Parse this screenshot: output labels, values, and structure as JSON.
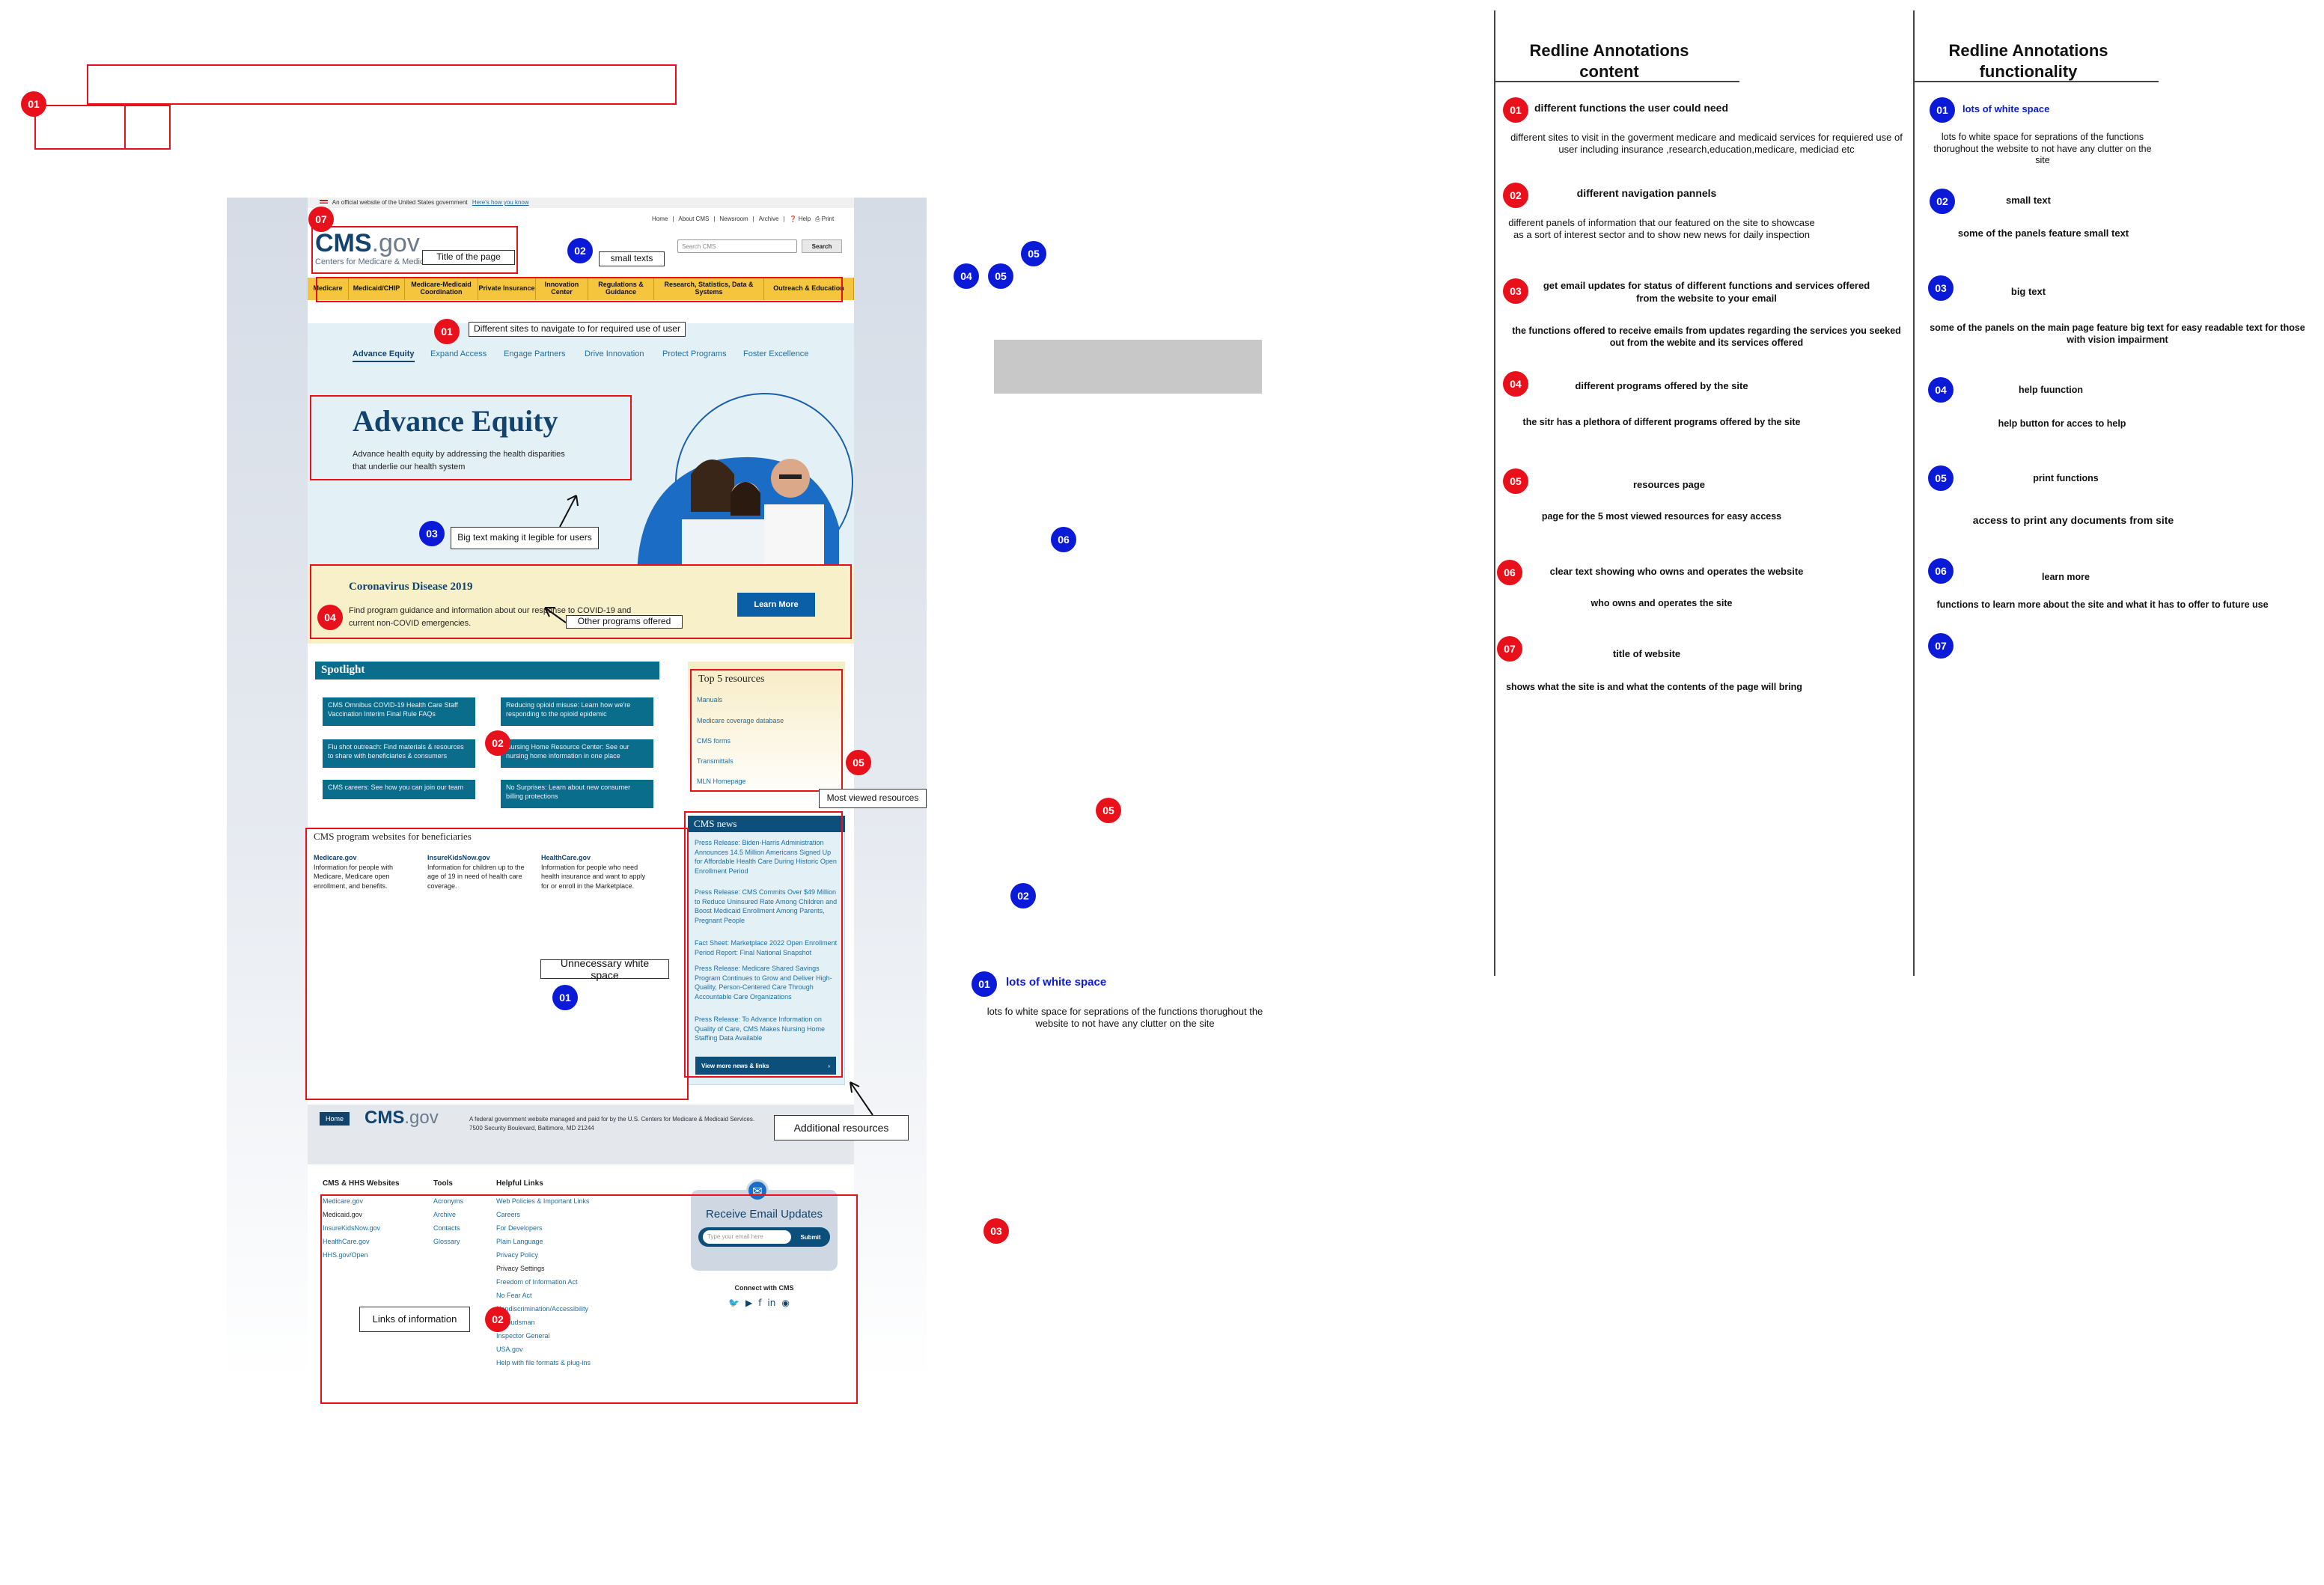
{
  "site": {
    "banner_text": "An official website of the United States government",
    "banner_link": "Here's how you know",
    "top_links": [
      "Home",
      "About CMS",
      "Newsroom",
      "Archive"
    ],
    "help": "Help",
    "print": "Print",
    "logo_main": "CMS",
    "logo_suffix": ".gov",
    "logo_tagline": "Centers for Medicare & Medicaid Services",
    "search_placeholder": "Search CMS",
    "search_button": "Search",
    "nav": [
      "Medicare",
      "Medicaid/CHIP",
      "Medicare-Medicaid Coordination",
      "Private Insurance",
      "Innovation Center",
      "Regulations & Guidance",
      "Research, Statistics, Data & Systems",
      "Outreach & Education"
    ],
    "sub_tabs": [
      "Advance Equity",
      "Expand Access",
      "Engage Partners",
      "Drive Innovation",
      "Protect Programs",
      "Foster Excellence"
    ],
    "hero_title": "Advance Equity",
    "hero_text": "Advance health equity by addressing the health disparities that underlie our health system",
    "covid_title": "Coronavirus Disease 2019",
    "covid_text": "Find program guidance and information about our response to COVID-19 and current non-COVID emergencies.",
    "learn_more": "Learn More",
    "spotlight_title": "Spotlight",
    "spotlight_items": [
      "CMS Omnibus COVID-19 Health Care Staff Vaccination Interim Final Rule FAQs",
      "Reducing opioid misuse: Learn how we're responding to the opioid epidemic",
      "Flu shot outreach: Find materials & resources to share with beneficiaries & consumers",
      "Nursing Home Resource Center: See our nursing home information in one place",
      "CMS careers: See how you can join our team",
      "No Surprises: Learn about new consumer billing protections"
    ],
    "top5_title": "Top 5 resources",
    "top5_items": [
      "Manuals",
      "Medicare coverage database",
      "CMS forms",
      "Transmittals",
      "MLN Homepage"
    ],
    "programs_title": "CMS program websites for beneficiaries",
    "programs": [
      {
        "name": "Medicare.gov",
        "desc": "Information for people with Medicare, Medicare open enrollment, and benefits."
      },
      {
        "name": "InsureKidsNow.gov",
        "desc": "Information for children up to the age of 19 in need of health care coverage."
      },
      {
        "name": "HealthCare.gov",
        "desc": "Information for people who need health insurance and want to apply for or enroll in the Marketplace."
      }
    ],
    "news_title": "CMS news",
    "news_items": [
      "Press Release: Biden-Harris Administration Announces 14.5 Million Americans Signed Up for Affordable Health Care During Historic Open Enrollment Period",
      "Press Release: CMS Commits Over $49 Million to Reduce Uninsured Rate Among Children and Boost Medicaid Enrollment Among Parents, Pregnant People",
      "Fact Sheet: Marketplace 2022 Open Enrollment Period Report: Final National Snapshot",
      "Press Release: Medicare Shared Savings Program Continues to Grow and Deliver High-Quality, Person-Centered Care Through Accountable Care Organizations",
      "Press Release: To Advance Information on Quality of Care, CMS Makes Nursing Home Staffing Data Available"
    ],
    "view_more_news": "View more news & links",
    "footer_home": "Home",
    "footer_text": "A federal government website managed and paid for by the U.S. Centers for Medicare & Medicaid Services. 7500 Security Boulevard, Baltimore, MD 21244",
    "footer_cols": [
      {
        "title": "CMS & HHS Websites",
        "links": [
          "Medicare.gov",
          "Medicaid.gov",
          "InsureKidsNow.gov",
          "HealthCare.gov",
          "HHS.gov/Open"
        ]
      },
      {
        "title": "Tools",
        "links": [
          "Acronyms",
          "Archive",
          "Contacts",
          "Glossary"
        ]
      },
      {
        "title": "Helpful Links",
        "links": [
          "Web Policies & Important Links",
          "Careers",
          "For Developers",
          "Plain Language",
          "Privacy Policy",
          "Privacy Settings",
          "Freedom of Information Act",
          "No Fear Act",
          "Nondiscrimination/Accessibility",
          "Ombudsman",
          "Inspector General",
          "USA.gov",
          "Help with file formats & plug-ins"
        ]
      }
    ],
    "email_title": "Receive Email Updates",
    "email_placeholder": "Type your email here",
    "email_submit": "Submit",
    "connect": "Connect with CMS"
  },
  "labels": {
    "title_of_page": "Title of the page",
    "small_texts": "small texts",
    "sites_navigate": "Different sites to navigate to for required use of user",
    "big_text": "Big text making it legible for users",
    "other_programs": "Other programs offered",
    "most_viewed": "Most viewed resources",
    "unnecessary_white": "Unnecessary white space",
    "additional_resources": "Additional resources",
    "links_info": "Links of information",
    "float_lots": "lots of white space",
    "float_lots_desc": "lots fo white space for seprations of the functions thorughout the website to not have any clutter on the site"
  },
  "content_panel": {
    "title": "Redline Annotations content",
    "items": [
      {
        "num": "01",
        "head": "different functions the user could need",
        "desc": "different sites to visit in the goverment medicare and medicaid services for requiered use of user including insurance ,research,education,medicare, mediciad etc"
      },
      {
        "num": "02",
        "head": "different navigation pannels",
        "desc": "different panels of information that our featured on the site to showcase as a sort of interest sector and to show new news for daily inspection"
      },
      {
        "num": "03",
        "head": "get email updates for status of different functions and services offered from the website to your email",
        "desc": "the functions offered to receive emails from updates regarding the services you seeked out from the webite and its services offered"
      },
      {
        "num": "04",
        "head": "different programs offered by the site",
        "desc": "the sitr has a plethora of different programs offered by the site"
      },
      {
        "num": "05",
        "head": "resources page",
        "desc": "page for the 5 most viewed resources for easy access"
      },
      {
        "num": "06",
        "head": "clear text showing who owns and operates the website",
        "desc": "who owns and operates the site"
      },
      {
        "num": "07",
        "head": "title of website",
        "desc": "shows what the site is and what the contents of the page will bring"
      }
    ]
  },
  "func_panel": {
    "title": "Redline Annotations functionality",
    "items": [
      {
        "num": "01",
        "head": "lots of white space",
        "desc": "lots fo white space for seprations of the functions thorughout the website to not have any clutter on the site"
      },
      {
        "num": "02",
        "head": "small text",
        "desc": "some of the panels feature small text"
      },
      {
        "num": "03",
        "head": "big text",
        "desc": "some of  the panels on the main page feature big text for easy readable text for those with vision impairment"
      },
      {
        "num": "04",
        "head": "help fuunction",
        "desc": "help button for acces to help"
      },
      {
        "num": "05",
        "head": "print functions",
        "desc": "access to print any documents from site"
      },
      {
        "num": "06",
        "head": "learn more",
        "desc": "functions to learn more about the site and what it has to offer to future use"
      },
      {
        "num": "07",
        "head": "",
        "desc": ""
      }
    ]
  },
  "colors": {
    "red": "#e8101a",
    "blue": "#0a1ad6",
    "nav_yellow": "#f4c53d",
    "teal": "#0b6d8c"
  }
}
